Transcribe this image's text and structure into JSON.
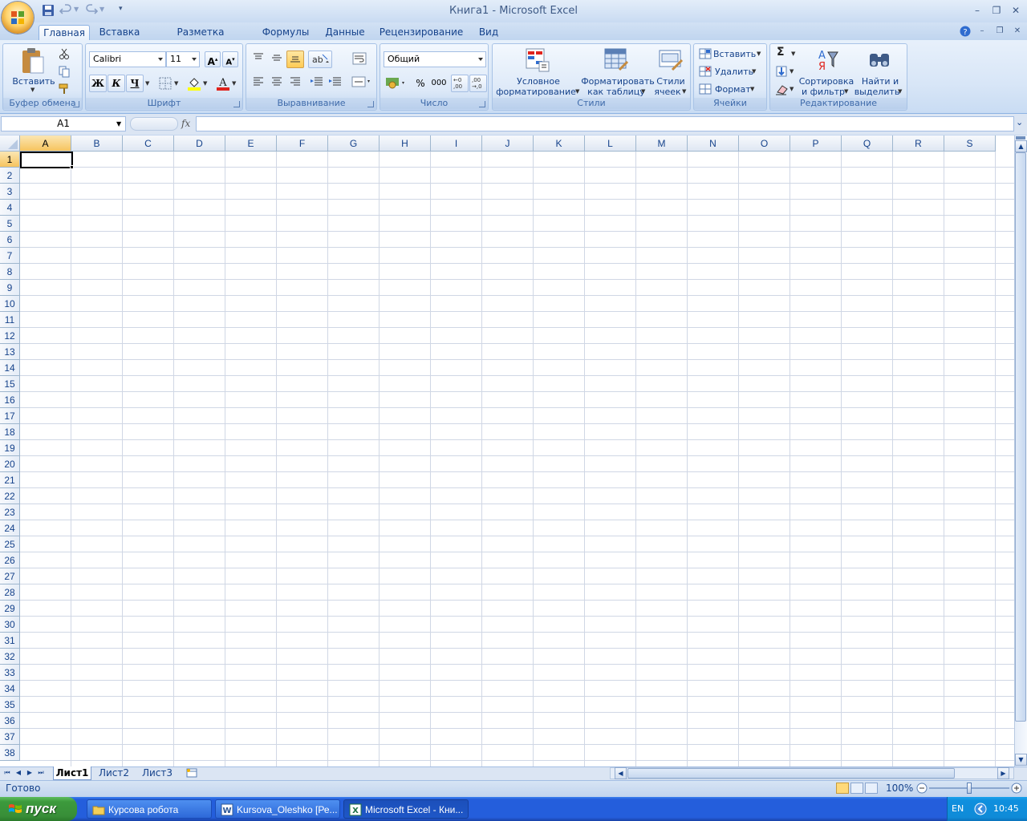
{
  "window": {
    "title": "Книга1 - Microsoft Excel",
    "minimize": "–",
    "restore": "❐",
    "close": "✕"
  },
  "ribbon_tabs": [
    {
      "label": "Главная"
    },
    {
      "label": "Вставка"
    },
    {
      "label": "Разметка страницы"
    },
    {
      "label": "Формулы"
    },
    {
      "label": "Данные"
    },
    {
      "label": "Рецензирование"
    },
    {
      "label": "Вид"
    }
  ],
  "active_tab": "Главная",
  "groups": {
    "clipboard": {
      "label": "Буфер обмена",
      "paste": "Вставить"
    },
    "font": {
      "label": "Шрифт",
      "font_name": "Calibri",
      "font_size": "11",
      "bold": "Ж",
      "italic": "К",
      "underline": "Ч"
    },
    "alignment": {
      "label": "Выравнивание"
    },
    "number": {
      "label": "Число",
      "format": "Общий",
      "percent": "%",
      "thousands": "000"
    },
    "styles": {
      "label": "Стили",
      "conditional_1": "Условное",
      "conditional_2": "форматирование",
      "table_1": "Форматировать",
      "table_2": "как таблицу",
      "cell_1": "Стили",
      "cell_2": "ячеек"
    },
    "cells": {
      "label": "Ячейки",
      "insert": "Вставить",
      "delete": "Удалить",
      "format": "Формат"
    },
    "editing": {
      "label": "Редактирование",
      "sum": "Σ",
      "sort_1": "Сортировка",
      "sort_2": "и фильтр",
      "find_1": "Найти и",
      "find_2": "выделить"
    }
  },
  "formula_bar": {
    "name_box": "A1",
    "fx": "fx",
    "formula": ""
  },
  "columns": [
    "A",
    "B",
    "C",
    "D",
    "E",
    "F",
    "G",
    "H",
    "I",
    "J",
    "K",
    "L",
    "M",
    "N",
    "O",
    "P",
    "Q",
    "R",
    "S"
  ],
  "rows": [
    "1",
    "2",
    "3",
    "4",
    "5",
    "6",
    "7",
    "8",
    "9",
    "10",
    "11",
    "12",
    "13",
    "14",
    "15",
    "16",
    "17",
    "18",
    "19",
    "20",
    "21",
    "22",
    "23",
    "24",
    "25",
    "26",
    "27",
    "28",
    "29",
    "30",
    "31",
    "32",
    "33",
    "34",
    "35",
    "36",
    "37",
    "38"
  ],
  "sheets": [
    {
      "label": "Лист1"
    },
    {
      "label": "Лист2"
    },
    {
      "label": "Лист3"
    }
  ],
  "status": {
    "text": "Готово",
    "zoom": "100%"
  },
  "taskbar": {
    "start": "пуск",
    "items": [
      {
        "label": "Курсова робота"
      },
      {
        "label": "Kursova_Oleshko [Ре..."
      },
      {
        "label": "Microsoft Excel - Кни..."
      }
    ],
    "lang": "EN",
    "clock": "10:45"
  },
  "colors": {
    "accent": "#15428b",
    "selection": "#f6c45f",
    "taskbar": "#245edc",
    "start": "#3c9a3c"
  }
}
